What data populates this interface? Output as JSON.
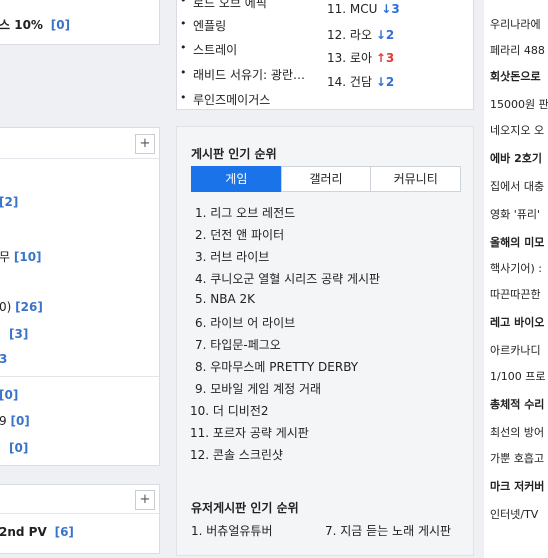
{
  "left_top": {
    "row_text": "스 10%",
    "row_count": "[0]"
  },
  "left_mid": {
    "plus": "+",
    "rows": [
      {
        "text": "",
        "count": "[2]"
      },
      {
        "text": "무",
        "count": "[10]"
      },
      {
        "text": "0)",
        "count": "[26]"
      },
      {
        "text": "",
        "count": "[3]"
      },
      {
        "text": "",
        "count": "3"
      },
      {
        "text": "",
        "count": "[0]"
      },
      {
        "text": "9",
        "count": "[0]"
      },
      {
        "text": "",
        "count": "[0]"
      }
    ]
  },
  "left_bot": {
    "plus": "+",
    "row_text": "2nd PV",
    "row_count": "[6]"
  },
  "issues": {
    "left": [
      "로드 오브 에픽",
      "엔플링",
      "스트레이",
      "래비드 서유기: 광란…",
      "루인즈메이거스"
    ],
    "right": [
      {
        "text": "11. MCU",
        "arrow": "↓",
        "num": "3",
        "dir": "down"
      },
      {
        "text": "12. 라오",
        "arrow": "↓",
        "num": "2",
        "dir": "down"
      },
      {
        "text": "13. 로아",
        "arrow": "↑",
        "num": "3",
        "dir": "up"
      },
      {
        "text": "14. 건담",
        "arrow": "↓",
        "num": "2",
        "dir": "down"
      }
    ]
  },
  "board_popular": {
    "title": "게시판 인기 순위",
    "tabs": [
      "게임",
      "갤러리",
      "커뮤니티"
    ],
    "active_tab": "게임",
    "items": [
      "1. 리그 오브 레전드",
      "2. 던전 앤 파이터",
      "3. 러브 라이브",
      "4. 쿠니오군 열혈 시리즈 공략 게시판",
      "5. NBA 2K",
      "6. 라이브 어 라이브",
      "7. 타입문-페그오",
      "8. 우마무스메 PRETTY DERBY",
      "9. 모바일 게임 계정 거래",
      "10. 더 디비전2",
      "11. 포르자 공략 게시판",
      "12. 콘솔 스크린샷"
    ]
  },
  "user_board": {
    "title": "유저게시판 인기 순위",
    "items": [
      "1. 버츄얼유튜버",
      "7. 지금 듣는 노래 게시판"
    ]
  },
  "right_col": {
    "lines": [
      {
        "text": "우리나라에",
        "bold": false
      },
      {
        "text": "페라리 488",
        "bold": false
      },
      {
        "text": "회삿돈으로",
        "bold": true
      },
      {
        "text": "15000원 판",
        "bold": false
      },
      {
        "text": "네오지오 오",
        "bold": false
      },
      {
        "text": "에바 2호기",
        "bold": true
      },
      {
        "text": "집에서 대충",
        "bold": false
      },
      {
        "text": "영화 '퓨리'",
        "bold": false
      },
      {
        "text": "올해의 미모",
        "bold": true
      },
      {
        "text": "핵사기어) :",
        "bold": false
      },
      {
        "text": "따끈따끈한",
        "bold": false
      },
      {
        "text": "레고 바이오",
        "bold": true
      },
      {
        "text": "아르카나디",
        "bold": false
      },
      {
        "text": "1/100 프로",
        "bold": false
      },
      {
        "text": "총체적 수리",
        "bold": true
      },
      {
        "text": "최선의 방어",
        "bold": false
      },
      {
        "text": "가뿐 호흡고",
        "bold": false
      },
      {
        "text": "마크 저커버",
        "bold": true
      },
      {
        "text": "인터넷/TV",
        "bold": false
      }
    ]
  }
}
